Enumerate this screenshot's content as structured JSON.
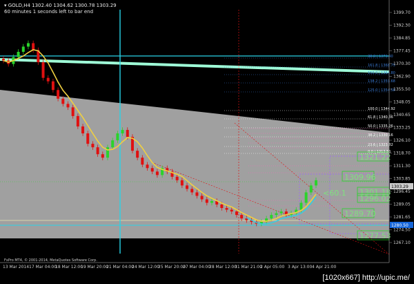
{
  "header": {
    "symbol_line": "GOLD,H4  1302.40 1304.62 1300.78 1303.29",
    "countdown": "60 minutes 1 seconds left to bar end"
  },
  "copyright": "FxPro MT4, © 2001-2014, MetaQuotes Software Corp.",
  "watermark": "[1020x667] http://upic.me/",
  "colors": {
    "background": "#000000",
    "gray_band": "#a0a0a0",
    "up_candle": "#2bd32b",
    "down_candle": "#e01010",
    "trendline": "#9fffd8",
    "cyan": "#29d3e8",
    "ma_line": "#f0d040",
    "bid_label": "#cccccc",
    "ask_label": "#1565d8"
  },
  "price_axis": [
    "1399.70",
    "1392.30",
    "1384.85",
    "1377.45",
    "1370.30",
    "1362.90",
    "1355.50",
    "1348.05",
    "1340.65",
    "1333.25",
    "1326.10",
    "1318.70",
    "1311.30",
    "1303.85",
    "1296.45",
    "1289.05",
    "1281.65",
    "1274.50",
    "1267.10"
  ],
  "current_price": "1303.29",
  "ask_price": "1280.50",
  "time_axis": [
    "13 Mar 2014",
    "17 Mar 04:00",
    "18 Mar 12:00",
    "19 Mar 20:00",
    "21 Mar 04:00",
    "24 Mar 12:00",
    "25 Mar 20:00",
    "27 Mar 04:00",
    "28 Mar 12:00",
    "31 Mar 21:00",
    "2 Apr 05:00",
    "3 Apr 13:00",
    "4 Apr 21:00"
  ],
  "fib_levels_upper": [
    "38.8 | 1373.40",
    "161.8 | 1368.75",
    "150.0 | 1364.80",
    "138.2 | 1359.68",
    "125.0 | 1354.58"
  ],
  "fib_levels_lower": [
    "100.0 | 1344.92",
    "61.8 | 1340.36",
    "50.0 | 1335.26",
    "38.2 | 1330.16",
    "23.6 | 1323.82",
    "0.0 | 1313.56"
  ],
  "boxes": [
    "1321.22",
    "1309.96",
    "1301.18",
    "1296.02",
    "1289.70",
    "1277.53"
  ],
  "arrow_text": "<60.1",
  "chart_data": {
    "type": "candlestick",
    "symbol": "GOLD",
    "timeframe": "H4",
    "ohlc": {
      "open": 1302.4,
      "high": 1304.62,
      "low": 1300.78,
      "close": 1303.29
    },
    "closes": [
      1372,
      1370,
      1374,
      1377,
      1380,
      1382,
      1378,
      1371,
      1362,
      1360,
      1355,
      1350,
      1347,
      1345,
      1340,
      1334,
      1330,
      1324,
      1322,
      1318,
      1316,
      1322,
      1326,
      1330,
      1332,
      1328,
      1320,
      1316,
      1312,
      1310,
      1308,
      1306,
      1310,
      1308,
      1305,
      1303,
      1300,
      1298,
      1296,
      1294,
      1292,
      1290,
      1291,
      1289,
      1287,
      1286,
      1285,
      1283,
      1281,
      1280,
      1279,
      1278,
      1279,
      1281,
      1283,
      1284,
      1285,
      1283,
      1284,
      1286,
      1290,
      1296,
      1300,
      1303
    ],
    "ylim": [
      1267.1,
      1399.7
    ]
  }
}
